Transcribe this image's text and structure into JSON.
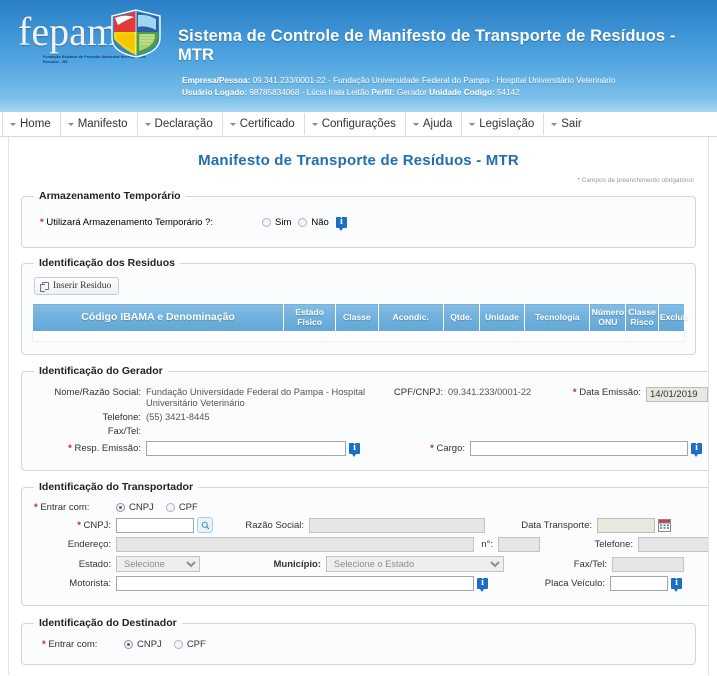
{
  "header": {
    "logo_word": "fepam",
    "logo_subtitle": "Fundação Estadual de Proteção Ambiental Henrique Luis Roessler - RS",
    "title": "Sistema de Controle de Manifesto de Transporte de Resíduos - MTR",
    "empresa_label": "Empresa/Pessoa:",
    "empresa_value": "09.341.233/0001-22 - Fundação Universidade Federal do Pampa - Hospital Universitário Veterinário",
    "usuario_label": "Usuário Logado:",
    "usuario_value": "98785834068 - Lúcia Irala Leitão",
    "perfil_label": "Perfil:",
    "perfil_value": "Gerador",
    "unidade_label": "Unidade",
    "codigo_label": "Codigo:",
    "codigo_value": "54142"
  },
  "menu": {
    "items": [
      {
        "label": "Home",
        "name": "home"
      },
      {
        "label": "Manifesto",
        "name": "manifesto"
      },
      {
        "label": "Declaração",
        "name": "declaracao"
      },
      {
        "label": "Certificado",
        "name": "certificado"
      },
      {
        "label": "Configurações",
        "name": "configuracoes"
      },
      {
        "label": "Ajuda",
        "name": "ajuda"
      },
      {
        "label": "Legislação",
        "name": "legislacao"
      },
      {
        "label": "Sair",
        "name": "sair"
      }
    ]
  },
  "page": {
    "title": "Manifesto de Transporte de Resíduos - MTR",
    "required_note": "* Campos de preenchimento obrigatório!"
  },
  "armazenamento": {
    "legend": "Armazenamento Temporário",
    "question": "Utilizará Armazenamento Temporário ?:",
    "option_yes": "Sim",
    "option_no": "Não",
    "selected": ""
  },
  "residuos": {
    "legend": "Identificação dos Residuos",
    "insert_button": "Inserir Residuo",
    "columns": [
      "Código IBAMA e Denominação",
      "Estado Físico",
      "Classe",
      "Acondic.",
      "Qtde.",
      "Unidade",
      "Tecnologia",
      "Número ONU",
      "Classe Risco",
      "Excluir"
    ],
    "rows": []
  },
  "gerador": {
    "legend": "Identificação do Gerador",
    "nome_label": "Nome/Razão Social:",
    "nome_value": "Fundação Universidade Federal do Pampa - Hospital Universitário Veterinário",
    "cpfcnpj_label": "CPF/CNPJ:",
    "cpfcnpj_value": "09.341.233/0001-22",
    "data_emissao_label": "Data Emissão:",
    "data_emissao_value": "14/01/2019",
    "telefone_label": "Telefone:",
    "telefone_value": "(55) 3421-8445",
    "faxtel_label": "Fax/Tel:",
    "faxtel_value": "",
    "resp_emissao_label": "Resp. Emissão:",
    "resp_emissao_value": "",
    "cargo_label": "Cargo:",
    "cargo_value": ""
  },
  "transportador": {
    "legend": "Identificação do Transportador",
    "entrar_com_label": "Entrar com:",
    "opt_cnpj": "CNPJ",
    "opt_cpf": "CPF",
    "selected_tipo": "CNPJ",
    "cnpj_label": "CNPJ:",
    "cnpj_value": "",
    "razao_label": "Razão Social:",
    "razao_value": "",
    "data_transporte_label": "Data Transporte:",
    "data_transporte_value": "",
    "endereco_label": "Endereço:",
    "endereco_value": "",
    "numero_label": "n°:",
    "numero_value": "",
    "telefone_label": "Telefone:",
    "telefone_value": "",
    "estado_label": "Estado:",
    "estado_value": "Selecione",
    "municipio_label": "Município:",
    "municipio_value": "Selecione o Estado",
    "faxtel_label": "Fax/Tel:",
    "faxtel_value": "",
    "motorista_label": "Motorista:",
    "motorista_value": "",
    "placa_label": "Placa Veículo:",
    "placa_value": ""
  },
  "destinador": {
    "legend": "Identificação do Destinador",
    "entrar_com_label": "Entrar com:",
    "opt_cnpj": "CNPJ",
    "opt_cpf": "CPF",
    "selected_tipo": "CNPJ"
  },
  "colors": {
    "banner_top": "#2a7fc4",
    "banner_bottom": "#a9d6f2",
    "title_blue": "#1f6fb2",
    "table_header": "#6fb0dc",
    "required_red": "#cc2222",
    "info_icon": "#1b6fc4"
  }
}
